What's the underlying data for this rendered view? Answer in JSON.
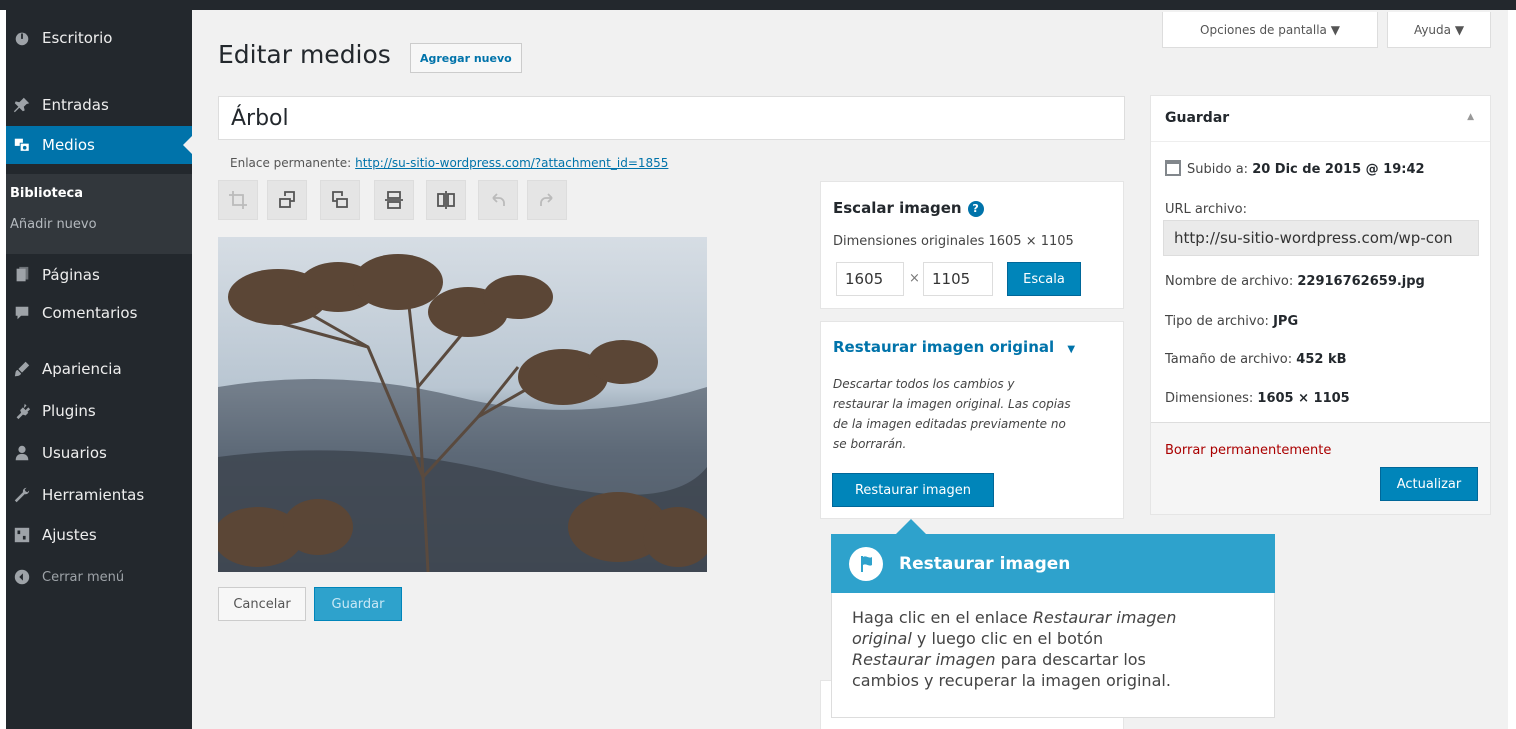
{
  "sidebar": {
    "items": [
      {
        "label": "Escritorio",
        "icon": "dashboard-icon"
      },
      {
        "label": "Entradas",
        "icon": "pin-icon"
      },
      {
        "label": "Medios",
        "icon": "media-icon"
      },
      {
        "label": "Páginas",
        "icon": "pages-icon"
      },
      {
        "label": "Comentarios",
        "icon": "comments-icon"
      },
      {
        "label": "Apariencia",
        "icon": "appearance-icon"
      },
      {
        "label": "Plugins",
        "icon": "plugins-icon"
      },
      {
        "label": "Usuarios",
        "icon": "users-icon"
      },
      {
        "label": "Herramientas",
        "icon": "tools-icon"
      },
      {
        "label": "Ajustes",
        "icon": "settings-icon"
      }
    ],
    "submenu": [
      "Biblioteca",
      "Añadir nuevo"
    ],
    "collapse_label": "Cerrar menú"
  },
  "header": {
    "title": "Editar medios",
    "add_new": "Agregar nuevo",
    "screen_options": "Opciones de pantalla ▼",
    "help": "Ayuda ▼"
  },
  "media": {
    "title": "Árbol",
    "permalink_label": "Enlace permanente:",
    "permalink_url": "http://su-sitio-wordpress.com/?attachment_id=1855"
  },
  "editor": {
    "cancel": "Cancelar",
    "save": "Guardar"
  },
  "scale": {
    "title": "Escalar imagen",
    "help_icon": "?",
    "original_dims": "Dimensiones originales 1605 × 1105",
    "width": "1605",
    "times": "×",
    "height": "1105",
    "button": "Escala"
  },
  "restore": {
    "title": "Restaurar imagen original",
    "caret": "▼",
    "description_lines": [
      "Descartar todos los cambios y",
      "restaurar la imagen original. Las copias",
      "de la imagen editadas previamente no",
      "se borrarán."
    ],
    "button": "Restaurar imagen"
  },
  "tooltip": {
    "title": "Restaurar imagen",
    "line1_a": "Haga clic en el enlace ",
    "line1_em": "Restaurar imagen",
    "line2_em": "original",
    "line2_b": " y luego clic en el botón",
    "line3_em": "Restaurar imagen",
    "line3_b": " para descartar los",
    "line4": "cambios y recuperar la imagen original."
  },
  "save_box": {
    "title": "Guardar",
    "uploaded_label": "Subido a:",
    "uploaded_value": "20 Dic de 2015 @ 19:42",
    "url_label": "URL archivo:",
    "url_value": "http://su-sitio-wordpress.com/wp-con",
    "filename_label": "Nombre de archivo:",
    "filename_value": "22916762659.jpg",
    "filetype_label": "Tipo de archivo:",
    "filetype_value": "JPG",
    "filesize_label": "Tamaño de archivo:",
    "filesize_value": "452 kB",
    "dims_label": "Dimensiones:",
    "dims_value": "1605 × 1105",
    "delete": "Borrar permanentemente",
    "update": "Actualizar"
  },
  "colors": {
    "sidebar": "#23282d",
    "accent": "#0073aa",
    "primary_button": "#0085ba",
    "tooltip": "#2ea2cc",
    "delete": "#a00"
  }
}
